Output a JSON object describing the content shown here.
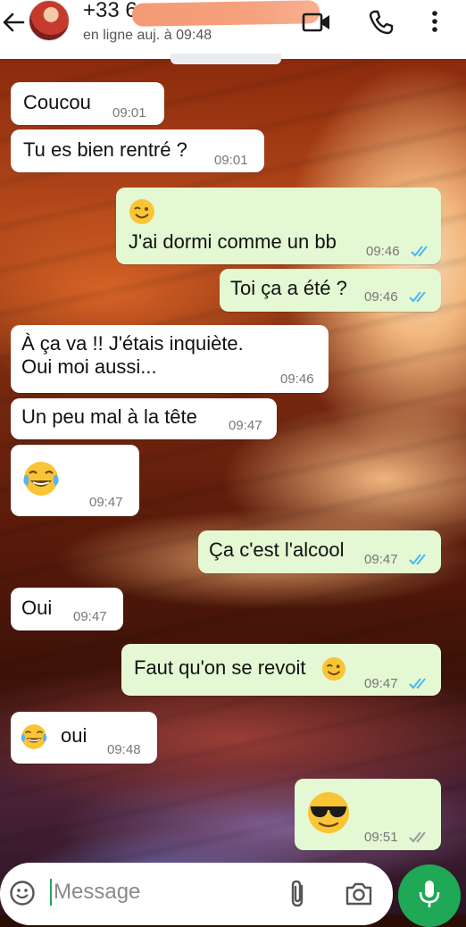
{
  "header": {
    "contact_name": "+33 6",
    "status": "en ligne auj. à 09:48"
  },
  "messages": [
    {
      "dir": "in",
      "text": "Coucou",
      "time": "09:01"
    },
    {
      "dir": "in",
      "text": "Tu es bien rentré ?",
      "time": "09:01"
    },
    {
      "dir": "out",
      "emoji": "wink",
      "text": "J'ai dormi comme un bb",
      "time": "09:46",
      "ticks": "read"
    },
    {
      "dir": "out",
      "text": "Toi ça a été ?",
      "time": "09:46",
      "ticks": "read"
    },
    {
      "dir": "in",
      "line1": "À ça va !! J'étais inquiète.",
      "line2": "Oui moi aussi...",
      "time": "09:46"
    },
    {
      "dir": "in",
      "text": "Un peu mal à la tête",
      "time": "09:47"
    },
    {
      "dir": "in",
      "emoji": "tears-of-joy",
      "time": "09:47"
    },
    {
      "dir": "out",
      "text": "Ça c'est l'alcool",
      "time": "09:47",
      "ticks": "read"
    },
    {
      "dir": "in",
      "text": "Oui",
      "time": "09:47"
    },
    {
      "dir": "out",
      "text": "Faut qu'on se revoit",
      "emoji": "wink",
      "time": "09:47",
      "ticks": "read"
    },
    {
      "dir": "in",
      "emoji": "tears-of-joy",
      "text": "oui",
      "time": "09:48"
    },
    {
      "dir": "out",
      "emoji": "sunglasses",
      "time": "09:51",
      "ticks": "delivered"
    }
  ],
  "composer": {
    "placeholder": "Message"
  },
  "colors": {
    "incoming_bubble": "#ffffff",
    "outgoing_bubble": "#e4f8d3",
    "read_ticks": "#4fb6ec",
    "delivered_ticks": "#9a9a9a",
    "mic_button": "#1fa855"
  },
  "icons": [
    "back-arrow-icon",
    "video-call-icon",
    "voice-call-icon",
    "more-options-icon",
    "emoji-icon",
    "attach-icon",
    "camera-icon",
    "mic-icon"
  ]
}
